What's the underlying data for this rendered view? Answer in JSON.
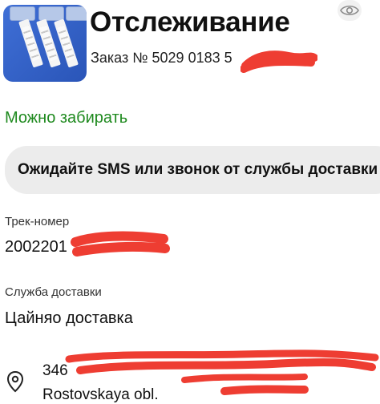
{
  "header": {
    "title": "Отслеживание",
    "order_text": "Заказ № 5029 0183 5",
    "visibility_icon": "eye-icon",
    "thumbnail": "product-image"
  },
  "status": {
    "text": "Можно забирать",
    "color": "#1f8a1f"
  },
  "banner": {
    "text": "Ожидайте SMS или звонок от службы доставки"
  },
  "tracking": {
    "label": "Трек-номер",
    "value": "2002201"
  },
  "delivery": {
    "label": "Служба доставки",
    "value": "Цайняо доставка"
  },
  "address": {
    "icon": "location-pin-icon",
    "line1": "346",
    "line2": "Rostovskaya obl."
  },
  "redaction_color": "#ee3d32"
}
